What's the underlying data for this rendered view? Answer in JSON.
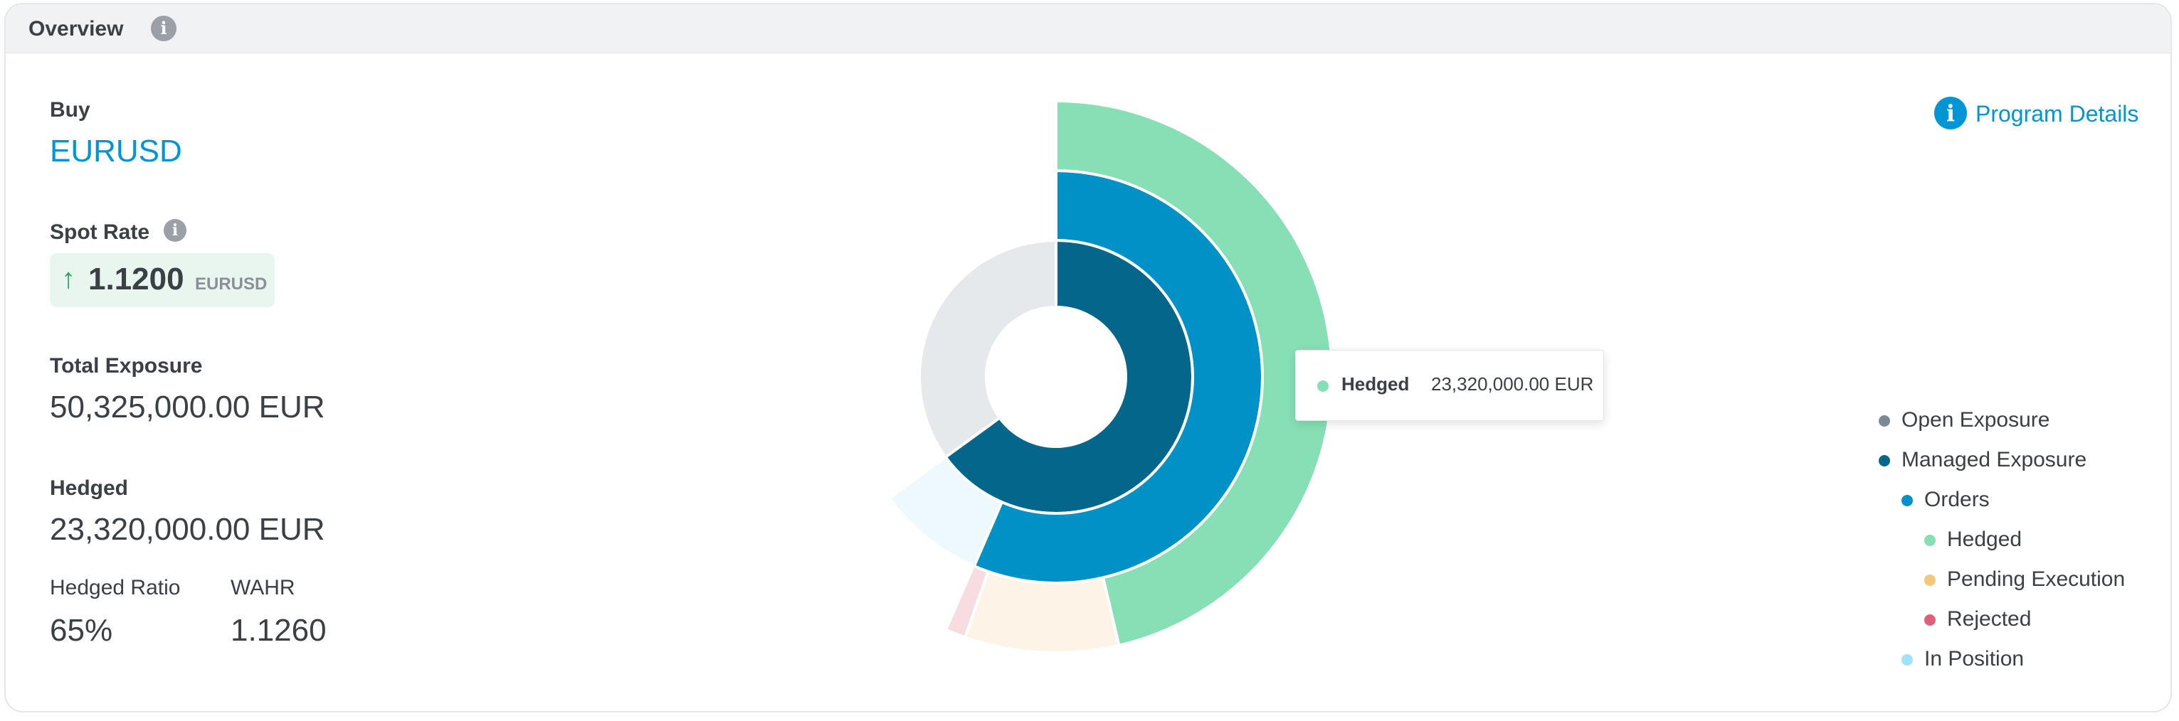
{
  "header": {
    "title": "Overview"
  },
  "summary": {
    "buy_label": "Buy",
    "pair": "EURUSD",
    "spot_rate_label": "Spot Rate",
    "spot_rate_value": "1.1200",
    "spot_rate_unit": "EURUSD",
    "spot_direction": "up-arrow-icon",
    "total_exposure_label": "Total Exposure",
    "total_exposure_value": "50,325,000.00 EUR",
    "hedged_label": "Hedged",
    "hedged_value": "23,320,000.00 EUR",
    "hedged_ratio_label": "Hedged Ratio",
    "hedged_ratio_value": "65%",
    "wahr_label": "WAHR",
    "wahr_value": "1.1260"
  },
  "program_details": {
    "label": "Program Details"
  },
  "tooltip": {
    "name": "Hedged",
    "value": "23,320,000.00 EUR"
  },
  "legend": [
    {
      "label": "Open Exposure",
      "color": "#7d8a96",
      "level": 0
    },
    {
      "label": "Managed Exposure",
      "color": "#03668a",
      "level": 0
    },
    {
      "label": "Orders",
      "color": "#0092c6",
      "level": 1
    },
    {
      "label": "Hedged",
      "color": "#86dfb5",
      "level": 2
    },
    {
      "label": "Pending Execution",
      "color": "#f5c878",
      "level": 2
    },
    {
      "label": "Rejected",
      "color": "#e0607a",
      "level": 2
    },
    {
      "label": "In Position",
      "color": "#9ee3f7",
      "level": 1
    }
  ],
  "colors": {
    "accent": "#0096d6",
    "open_exposure_ring": "#e6e9ec",
    "managed_ring": "#03668a",
    "orders_ring": "#0092c6",
    "in_position_ring": "#eef9fd",
    "hedged_ring": "#86dfb5",
    "pending_ring": "#fdf3e6",
    "rejected_ring": "#f7dde2"
  },
  "chart_data": {
    "type": "sunburst",
    "rings": [
      {
        "level": 1,
        "segments": [
          {
            "name": "Managed Exposure",
            "fraction": 0.65,
            "color": "#03668a"
          },
          {
            "name": "Open Exposure",
            "fraction": 0.35,
            "color": "#e6e9ec"
          }
        ]
      },
      {
        "level": 2,
        "segments": [
          {
            "name": "Orders",
            "fraction": 0.565,
            "color": "#0092c6"
          },
          {
            "name": "In Position",
            "fraction": 0.085,
            "color": "#eef9fd"
          }
        ]
      },
      {
        "level": 3,
        "segments": [
          {
            "name": "Hedged",
            "fraction": 0.4634,
            "color": "#86dfb5"
          },
          {
            "name": "Pending Execution",
            "fraction": 0.09,
            "color": "#fdf3e6"
          },
          {
            "name": "Rejected",
            "fraction": 0.012,
            "color": "#f7dde2"
          }
        ]
      }
    ]
  }
}
